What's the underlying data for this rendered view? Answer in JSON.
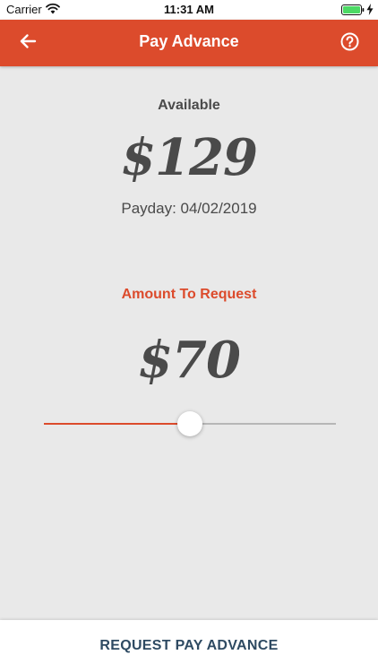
{
  "status_bar": {
    "carrier": "Carrier",
    "time": "11:31 AM",
    "wifi_icon": "wifi-icon",
    "battery_icon": "battery-icon",
    "battery_color": "#4cd964"
  },
  "nav": {
    "title": "Pay Advance",
    "back_icon": "arrow-left-icon",
    "help_icon": "question-circle-icon",
    "background_color": "#dc4b2c"
  },
  "available": {
    "label": "Available",
    "amount": "$129",
    "payday": "Payday: 04/02/2019"
  },
  "request": {
    "label": "Amount To Request",
    "amount": "$70",
    "slider_fraction": 0.5,
    "accent_color": "#dc4b2c"
  },
  "actions": {
    "request_button_label": "REQUEST PAY ADVANCE"
  }
}
